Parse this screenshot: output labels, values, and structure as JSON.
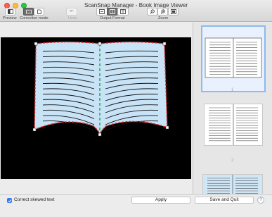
{
  "window": {
    "title": "ScanSnap Manager - Book Image Viewer"
  },
  "toolbar": {
    "preview_label": "Preview",
    "correction_mode_label": "Correction mode",
    "undo_label": "Undo",
    "output_format_label": "Output Format",
    "zoom_label": "Zoom"
  },
  "thumbnails": [
    {
      "page_number": "1",
      "selected": true
    },
    {
      "page_number": "2",
      "selected": false
    },
    {
      "page_number": "",
      "selected": false
    }
  ],
  "footer": {
    "correct_skew_label": "Correct skewed text",
    "correct_skew_checked": true,
    "apply_label": "Apply",
    "save_quit_label": "Save and Quit",
    "help_label": "?"
  },
  "colors": {
    "page_fill": "#c9e3f6",
    "crop_outline": "#d81f26",
    "spine_guide": "#1fa64b",
    "selection": "#8fb9f0"
  }
}
